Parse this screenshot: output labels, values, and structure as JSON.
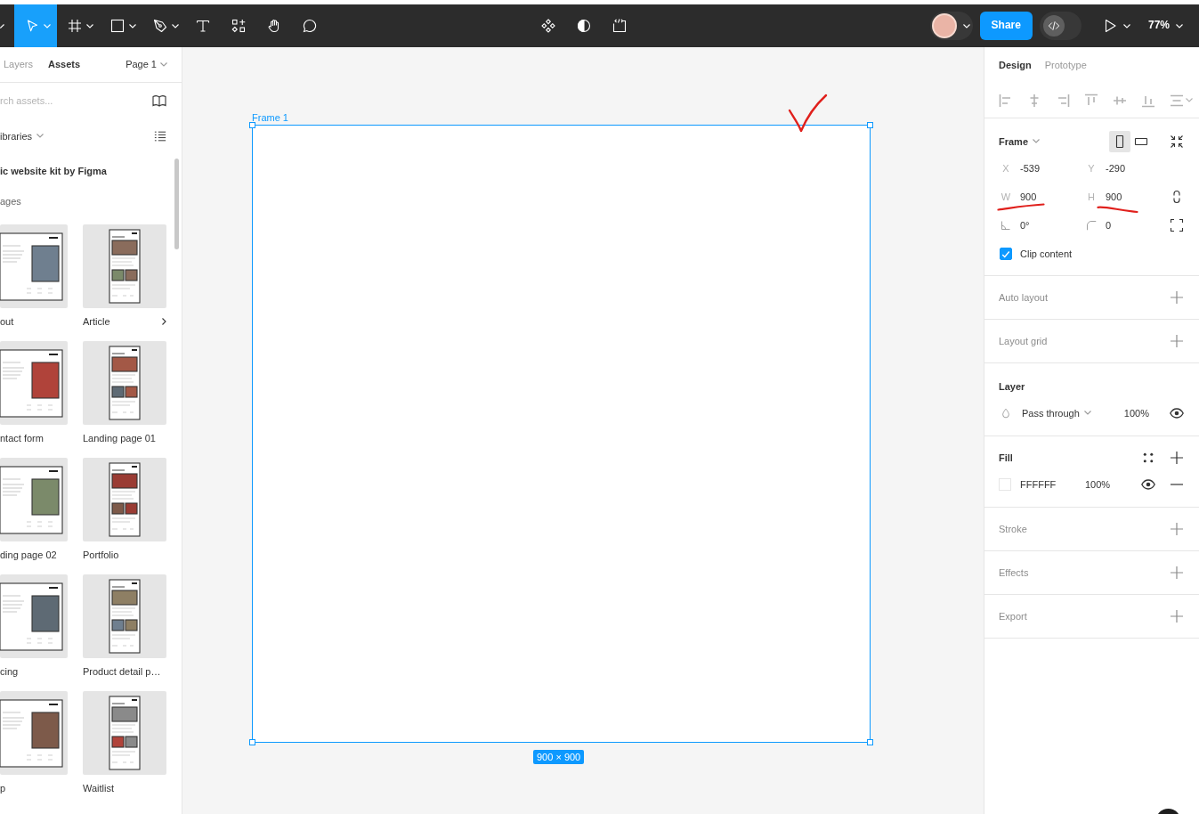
{
  "toolbar": {
    "tools": [
      {
        "kind": "move",
        "selected": true,
        "menu": true
      },
      {
        "kind": "frame",
        "selected": false,
        "menu": true
      },
      {
        "kind": "shape",
        "selected": false,
        "menu": true
      },
      {
        "kind": "pen",
        "selected": false,
        "menu": true
      },
      {
        "kind": "text",
        "selected": false,
        "menu": false
      },
      {
        "kind": "resources",
        "selected": false,
        "menu": false
      },
      {
        "kind": "hand",
        "selected": false,
        "menu": false
      },
      {
        "kind": "comment",
        "selected": false,
        "menu": false
      }
    ],
    "share": "Share",
    "dev_mode": {
      "on": false
    },
    "zoom": "77%"
  },
  "left_panel": {
    "tabs": [
      {
        "label": "Layers",
        "selected": false
      },
      {
        "label": "Assets",
        "selected": true
      }
    ],
    "page": "Page 1",
    "search": {
      "placeholder": "rch assets..."
    },
    "libraries": "ibraries",
    "library_title": "ic website kit by Figma",
    "group_title": "ages",
    "assets": [
      {
        "label": "out",
        "more": false
      },
      {
        "label": "Article",
        "more": true
      },
      {
        "label": "ntact form",
        "more": false
      },
      {
        "label": "Landing page 01",
        "more": false
      },
      {
        "label": "ding page 02",
        "more": false
      },
      {
        "label": "Portfolio",
        "more": false
      },
      {
        "label": "cing",
        "more": false
      },
      {
        "label": "Product detail p…",
        "more": false
      },
      {
        "label": "p",
        "more": false
      },
      {
        "label": "Waitlist",
        "more": false
      }
    ]
  },
  "canvas": {
    "frame": {
      "label": "Frame 1",
      "selected": true,
      "size": "900 × 900"
    }
  },
  "design_panel": {
    "tabs": [
      {
        "label": "Design",
        "selected": true
      },
      {
        "label": "Prototype",
        "selected": false
      }
    ],
    "sections": [
      {
        "kind": "frame",
        "title": "Frame",
        "orientation": [
          {
            "kind": "portrait",
            "selected": true
          },
          {
            "kind": "landscape",
            "selected": false
          }
        ],
        "fields": [
          {
            "kind": "letter",
            "label": "X",
            "value": "-539"
          },
          {
            "kind": "letter",
            "label": "Y",
            "value": "-290"
          },
          {
            "kind": "letter",
            "label": "W",
            "value": "900"
          },
          {
            "kind": "letter",
            "label": "H",
            "value": "900"
          },
          {
            "kind": "rotation",
            "value": "0°"
          },
          {
            "kind": "radius",
            "value": "0"
          }
        ],
        "clip_content": {
          "label": "Clip content",
          "checked": true
        }
      },
      {
        "kind": "empty",
        "title": "Auto layout"
      },
      {
        "kind": "empty",
        "title": "Layout grid"
      },
      {
        "kind": "layer",
        "title": "Layer",
        "blend": "Pass through",
        "opacity": "100%",
        "visible": true
      },
      {
        "kind": "fill",
        "title": "Fill",
        "fills": [
          {
            "color": "#ffffff",
            "hex": "FFFFFF",
            "opacity": "100%",
            "visible": true
          }
        ]
      },
      {
        "kind": "empty",
        "title": "Stroke"
      },
      {
        "kind": "empty",
        "title": "Effects"
      },
      {
        "kind": "empty",
        "title": "Export"
      }
    ]
  }
}
